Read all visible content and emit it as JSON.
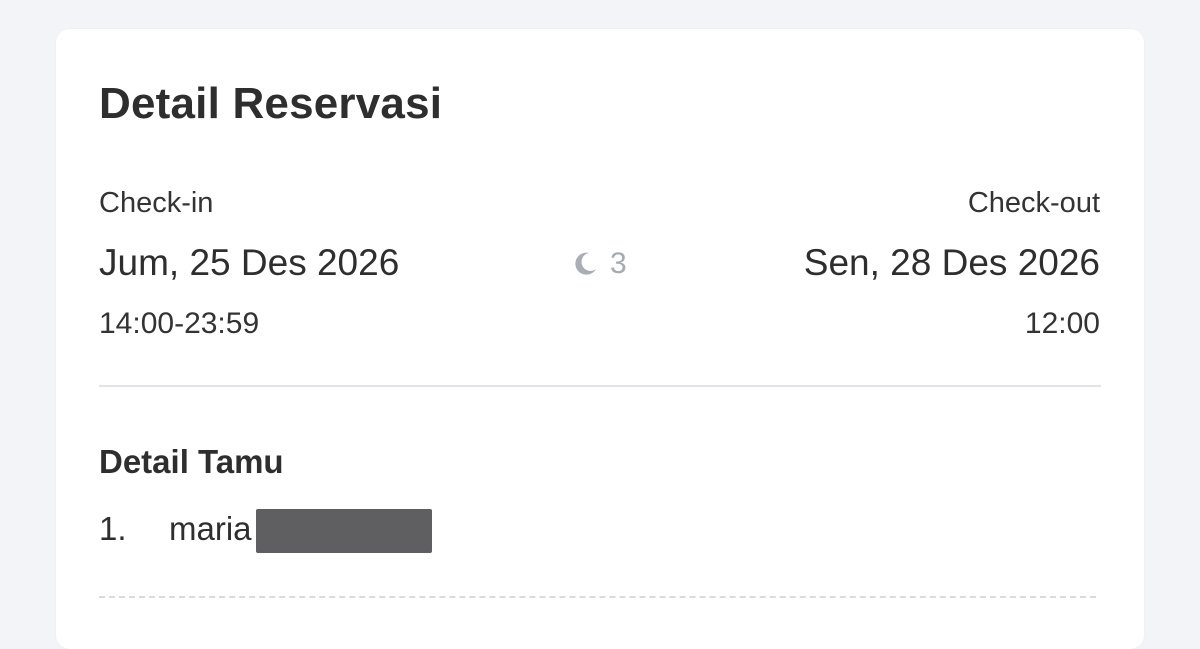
{
  "reservation": {
    "title": "Detail Reservasi",
    "checkin": {
      "label": "Check-in",
      "date": "Jum, 25 Des 2026",
      "time": "14:00-23:59"
    },
    "checkout": {
      "label": "Check-out",
      "date": "Sen, 28 Des 2026",
      "time": "12:00"
    },
    "nights": {
      "icon": "moon-icon",
      "count": "3"
    }
  },
  "guests": {
    "title": "Detail Tamu",
    "list": [
      {
        "index": "1.",
        "name": "maria"
      }
    ]
  }
}
